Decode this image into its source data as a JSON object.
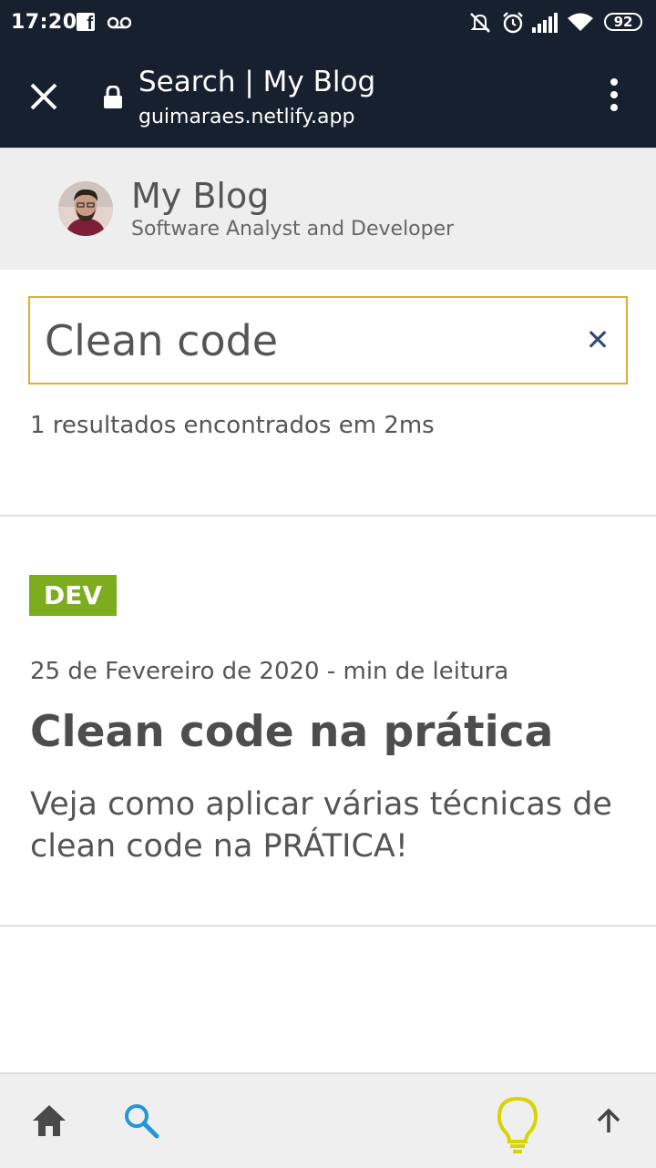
{
  "status_bar": {
    "time": "17:20",
    "icons": [
      "facebook-icon",
      "voicemail-icon",
      "mute-icon",
      "alarm-icon",
      "signal-icon",
      "wifi-icon"
    ],
    "battery": "92"
  },
  "browser": {
    "title": "Search | My Blog",
    "url": "guimaraes.netlify.app"
  },
  "blog": {
    "title": "My Blog",
    "subtitle": "Software Analyst and Developer"
  },
  "search": {
    "value": "Clean code",
    "clear_icon": "close-icon",
    "accent": "#e0ad35",
    "result_count": "1 resultados encontrados em 2ms"
  },
  "results": [
    {
      "tag": "DEV",
      "tag_color": "#7cad1e",
      "meta": "25 de Fevereiro de 2020 - min de leitura",
      "title": "Clean code na prática",
      "description": "Veja como aplicar várias técnicas de clean code na PRÁTICA!"
    }
  ],
  "bottom_nav": {
    "items": [
      "home-icon",
      "search-icon",
      "lightbulb-icon",
      "arrow-up-icon"
    ],
    "search_color": "#2196d8",
    "lightbulb_color": "#d7d400"
  }
}
